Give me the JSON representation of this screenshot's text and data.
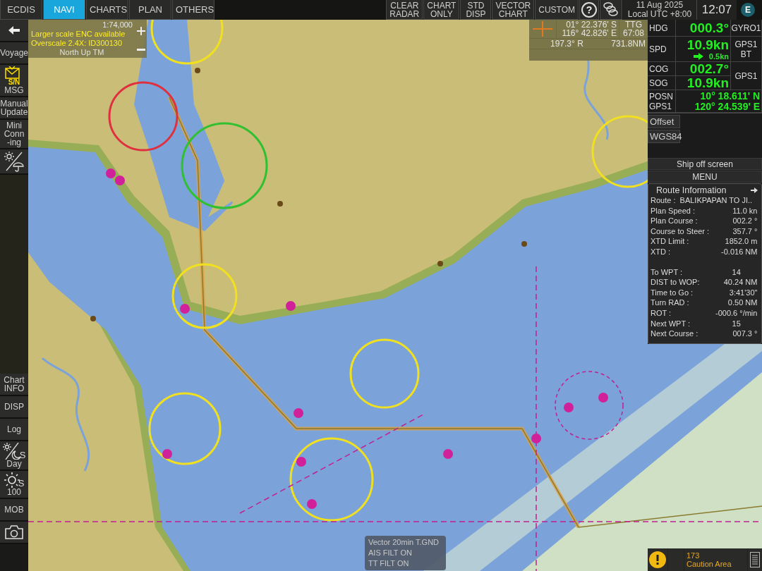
{
  "tabs": [
    {
      "label": "ECDIS",
      "selected": false
    },
    {
      "label": "NAVI",
      "selected": true
    },
    {
      "label": "CHARTS",
      "selected": false
    },
    {
      "label": "PLAN",
      "selected": false
    },
    {
      "label": "OTHERS",
      "selected": false
    }
  ],
  "toolbar": [
    {
      "kind": "text",
      "lines": [
        "CLEAR",
        "RADAR"
      ]
    },
    {
      "kind": "text",
      "lines": [
        "CHART",
        "ONLY"
      ]
    },
    {
      "kind": "text",
      "lines": [
        "STD",
        "DISP"
      ]
    },
    {
      "kind": "text",
      "lines": [
        "VECTOR",
        "CHART"
      ]
    },
    {
      "kind": "text",
      "lines": [
        "CUSTOM"
      ]
    },
    {
      "kind": "help",
      "label": "?"
    },
    {
      "kind": "layers"
    }
  ],
  "date": "11 Aug 2025",
  "timezone": "Local UTC +8:00",
  "clock": "12:07",
  "mode_badge": "E",
  "sidebar": {
    "top": [
      {
        "kind": "back"
      },
      {
        "kind": "text",
        "lines": [
          "Voyage"
        ]
      },
      {
        "kind": "envelope",
        "icon_text": "S/N",
        "lines": [
          "MSG"
        ]
      },
      {
        "kind": "text",
        "lines": [
          "Manual",
          "Update"
        ]
      },
      {
        "kind": "text",
        "lines": [
          "Mini",
          "Conn",
          "-ing"
        ]
      },
      {
        "kind": "weather"
      }
    ],
    "bottom": [
      {
        "kind": "text",
        "lines": [
          "Chart",
          "INFO"
        ]
      },
      {
        "kind": "text",
        "lines": [
          "DISP"
        ]
      },
      {
        "kind": "text",
        "lines": [
          "Log"
        ]
      },
      {
        "kind": "daynight",
        "icon_text": "S",
        "lines": [
          "Day"
        ]
      },
      {
        "kind": "brightness",
        "icon_text": "S",
        "lines": [
          "100"
        ]
      },
      {
        "kind": "text",
        "lines": [
          "MOB"
        ]
      },
      {
        "kind": "camera"
      }
    ]
  },
  "chart_info": {
    "scale": "1:74,000",
    "notice": "Larger scale ENC available",
    "overscale": "Overscale 2.4X: ID300130",
    "orientation": "North Up TM"
  },
  "cursor": {
    "lat": "01° 22.376' S",
    "lon": "116° 42.826' E",
    "ttg_label": "TTG",
    "ttg": "67:08",
    "bearing": "197.3° R",
    "distance": "731.8NM"
  },
  "sensors": {
    "hdg": {
      "label": "HDG",
      "value": "000.3°",
      "source": "GYRO1"
    },
    "spd": {
      "label": "SPD",
      "value": "10.9kn",
      "drift": "0.5kn",
      "source": [
        "GPS1",
        "BT"
      ]
    },
    "cog": {
      "label": "COG",
      "value": "002.7°"
    },
    "sog": {
      "label": "SOG",
      "value": "10.9kn"
    },
    "course_source": "GPS1",
    "posn": {
      "labels": [
        "POSN",
        "GPS1"
      ],
      "lat": "10° 18.611' N",
      "lon": "120° 24.539' E"
    }
  },
  "datum": {
    "offset": "Offset",
    "name": "WGS84"
  },
  "ship_off_screen": "Ship off screen",
  "menu": "MENU",
  "route_info": {
    "title": "Route Information",
    "groups": [
      [
        {
          "label": "Route :",
          "value": "BALIKPAPAN TO JI.."
        },
        {
          "label": "Plan Speed :",
          "value": "11.0 kn"
        },
        {
          "label": "Plan Course :",
          "value": "002.2 °"
        },
        {
          "label": "Course to Steer :",
          "value": "357.7 °"
        },
        {
          "label": "XTD Limit :",
          "value": "1852.0 m"
        },
        {
          "label": "XTD :",
          "value": "-0.016 NM"
        }
      ],
      [
        {
          "label": "To WPT :",
          "value": "14"
        },
        {
          "label": "DIST to WOP:",
          "value": "40.24 NM"
        },
        {
          "label": "Time to Go :",
          "value": "3:41'30\""
        },
        {
          "label": "Turn RAD :",
          "value": "0.50 NM"
        },
        {
          "label": "ROT :",
          "value": "-000.6 °/min"
        },
        {
          "label": "Next WPT :",
          "value": "15"
        },
        {
          "label": "Next Course :",
          "value": "007.3 °"
        }
      ]
    ]
  },
  "vector_box": [
    "Vector 20min T.GND",
    "AIS FILT ON",
    "TT FILT ON"
  ],
  "alert": {
    "count": "173",
    "text": "Caution Area"
  }
}
